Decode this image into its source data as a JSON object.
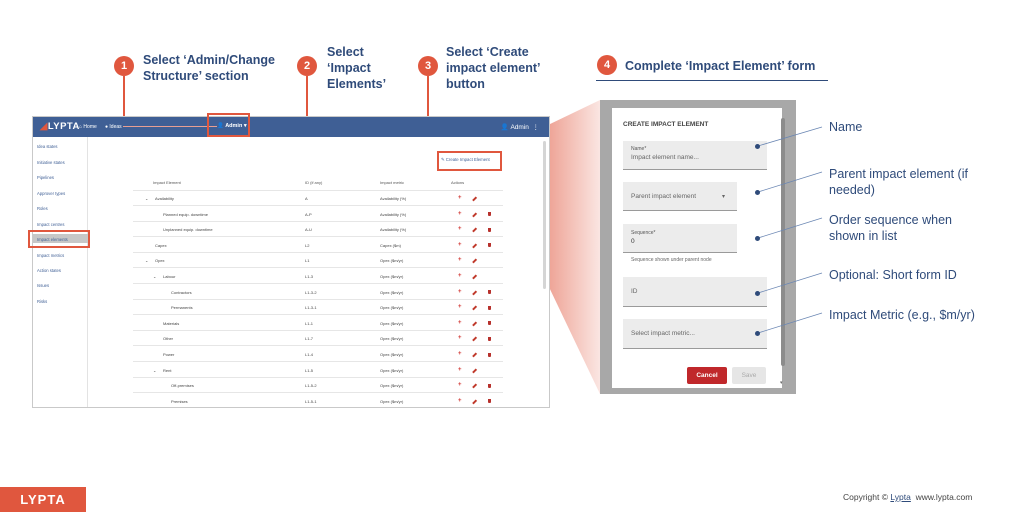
{
  "steps": [
    {
      "num": "1",
      "text": "Select ‘Admin/Change\nStructure’ section"
    },
    {
      "num": "2",
      "text": "Select\n‘Impact\nElements’"
    },
    {
      "num": "3",
      "text": "Select ‘Create\nimpact element’\nbutton"
    },
    {
      "num": "4",
      "text": "Complete ‘Impact Element’ form"
    }
  ],
  "accent_color": "#e0573e",
  "brand_color": "#3f5f95",
  "app": {
    "logo": "LYPTA",
    "nav": {
      "home": "Home",
      "ideas": "Ideas",
      "admin": "Admin"
    },
    "user": "Admin",
    "sidebar": [
      "Idea states",
      "Initiative states",
      "Pipelines",
      "Approver types",
      "Roles",
      "Impact centres",
      "Impact elements",
      "Impact metrics",
      "Action states",
      "Issues",
      "Risks"
    ],
    "create_button": "Create Impact Element",
    "headers": {
      "element": "Impact Element",
      "id": "ID (if any)",
      "metric": "Impact metric",
      "actions": "Actions"
    },
    "rows": [
      {
        "name": "Availability",
        "id": "A",
        "metric": "Availability (%)",
        "indent": 0,
        "chev": true,
        "del": false
      },
      {
        "name": "Planned equip. downtime",
        "id": "A-P",
        "metric": "Availability (%)",
        "indent": 1,
        "chev": false,
        "del": true
      },
      {
        "name": "Unplanned equip. downtime",
        "id": "A-U",
        "metric": "Availability (%)",
        "indent": 1,
        "chev": false,
        "del": true
      },
      {
        "name": "Capex",
        "id": "L2",
        "metric": "Capex ($m)",
        "indent": 0,
        "chev": false,
        "del": true
      },
      {
        "name": "Opex",
        "id": "L1",
        "metric": "Opex ($m/yr)",
        "indent": 0,
        "chev": true,
        "del": false
      },
      {
        "name": "Labour",
        "id": "L1-3",
        "metric": "Opex ($m/yr)",
        "indent": 1,
        "chev": true,
        "del": false
      },
      {
        "name": "Contractors",
        "id": "L1-3-2",
        "metric": "Opex ($m/yr)",
        "indent": 2,
        "chev": false,
        "del": true
      },
      {
        "name": "Permanents",
        "id": "L1-3-1",
        "metric": "Opex ($m/yr)",
        "indent": 2,
        "chev": false,
        "del": true
      },
      {
        "name": "Materials",
        "id": "L1-1",
        "metric": "Opex ($m/yr)",
        "indent": 1,
        "chev": false,
        "del": true
      },
      {
        "name": "Other",
        "id": "L1-7",
        "metric": "Opex ($m/yr)",
        "indent": 1,
        "chev": false,
        "del": true
      },
      {
        "name": "Power",
        "id": "L1-4",
        "metric": "Opex ($m/yr)",
        "indent": 1,
        "chev": false,
        "del": true
      },
      {
        "name": "Rent",
        "id": "L1-5",
        "metric": "Opex ($m/yr)",
        "indent": 1,
        "chev": true,
        "del": false
      },
      {
        "name": "Off-premises",
        "id": "L1-5-2",
        "metric": "Opex ($m/yr)",
        "indent": 2,
        "chev": false,
        "del": true
      },
      {
        "name": "Premises",
        "id": "L1-5-1",
        "metric": "Opex ($m/yr)",
        "indent": 2,
        "chev": false,
        "del": true
      }
    ]
  },
  "form": {
    "title": "CREATE IMPACT ELEMENT",
    "name_label": "Name*",
    "name_placeholder": "Impact element name...",
    "parent_placeholder": "Parent impact element",
    "sequence_label": "Sequence*",
    "sequence_value": "0",
    "sequence_helper": "Sequence shown under parent\nnode",
    "id_placeholder": "ID",
    "metric_placeholder": "Select impact metric...",
    "cancel": "Cancel",
    "save": "Save"
  },
  "annotations": [
    "Name",
    "Parent impact element (if\nneeded)",
    "Order sequence when\nshown in list",
    "Optional: Short form ID",
    "Impact Metric (e.g., $m/yr)"
  ],
  "footer": {
    "logo": "LYPTA",
    "copyright_prefix": "Copyright ©",
    "copyright_company": "Lypta",
    "website": "www.lypta.com"
  }
}
